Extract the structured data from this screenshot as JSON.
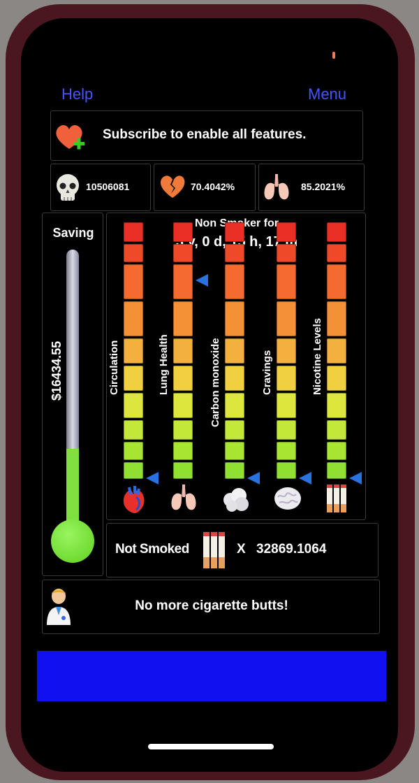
{
  "nav": {
    "help_label": "Help",
    "menu_label": "Menu"
  },
  "subscribe": {
    "text": "Subscribe to enable all features."
  },
  "stats": [
    {
      "icon": "skull-icon",
      "value": "10506081"
    },
    {
      "icon": "broken-heart-icon",
      "value": "70.4042%"
    },
    {
      "icon": "lungs-icon",
      "value": "85.2021%"
    }
  ],
  "saving": {
    "label": "Saving",
    "amount": "$16434.55",
    "fill_fraction": 0.28
  },
  "status": {
    "title": "Non Smoker for",
    "duration": "3 y, 0 d, 15 h, 17 m"
  },
  "meters": [
    {
      "label": "Circulation",
      "icon": "heart-organ-icon",
      "level": 0.0
    },
    {
      "label": "Lung Health",
      "icon": "lungs-organ-icon",
      "level": 0.77
    },
    {
      "label": "Carbon monoxide",
      "icon": "smoke-cloud-icon",
      "level": 0.0
    },
    {
      "label": "Cravings",
      "icon": "brain-icon",
      "level": 0.0
    },
    {
      "label": "Nicotine Levels",
      "icon": "cigarettes-icon",
      "level": 0.0
    }
  ],
  "not_smoked": {
    "label": "Not Smoked",
    "multiplier": "X",
    "count": "32869.1064"
  },
  "message": {
    "text": "No more cigarette butts!"
  },
  "colors": {
    "accent_link": "#4455ff",
    "ad_banner": "#1010f0",
    "thermo_fill": "#7fe040",
    "scale": [
      "#8fe030",
      "#a8e432",
      "#c4e838",
      "#dce63c",
      "#f0d040",
      "#f4b03e",
      "#f49036",
      "#f46a30",
      "#ee4a2a",
      "#ea3026"
    ]
  }
}
